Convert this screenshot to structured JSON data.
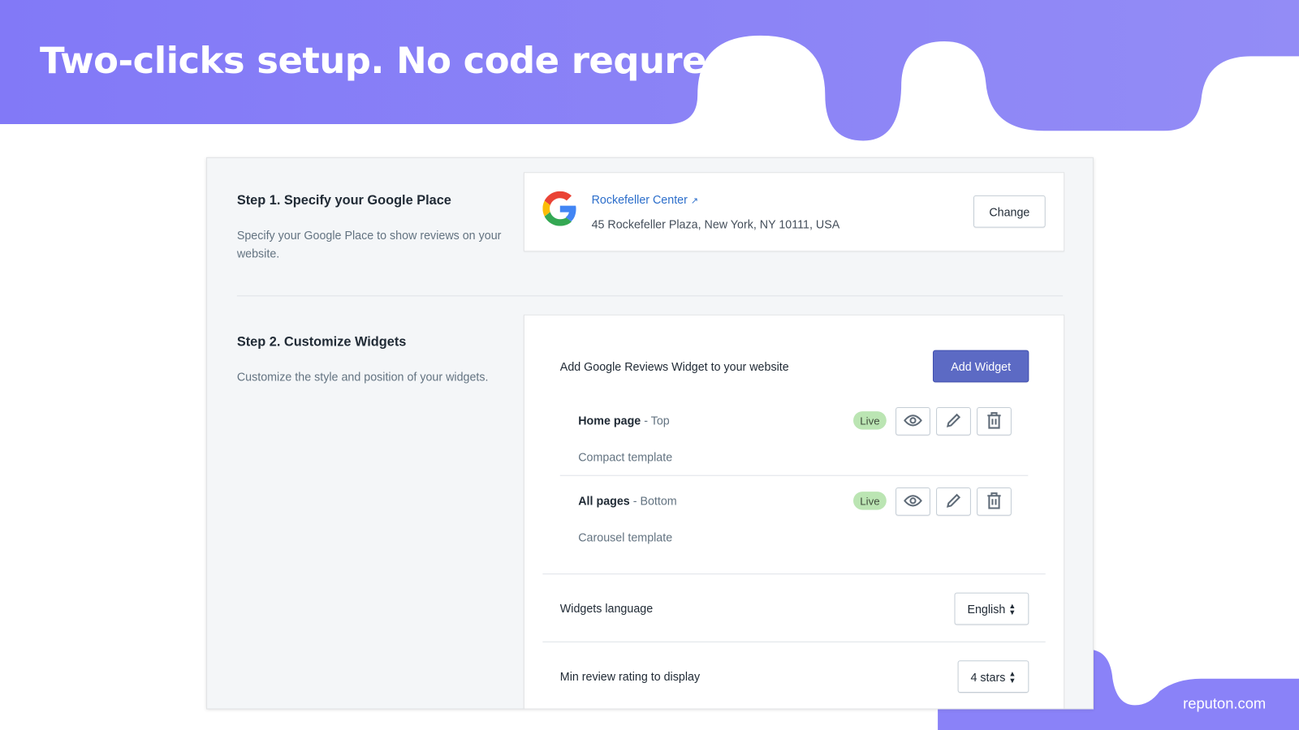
{
  "headline": "Two-clicks setup. No code requred",
  "brand": "reputon.com",
  "colors": {
    "banner": "#8a82f8",
    "accent": "#5c6ac4",
    "live": "#bbe5b3"
  },
  "step1": {
    "title": "Step 1. Specify your Google Place",
    "description": "Specify your Google Place to show reviews on your website.",
    "place_name": "Rockefeller Center",
    "place_address": "45 Rockefeller Plaza, New York, NY 10111, USA",
    "change_label": "Change",
    "logo_icon": "google-logo",
    "link_icon": "external-link-icon"
  },
  "step2": {
    "title": "Step 2. Customize Widgets",
    "description": "Customize the style and position of your widgets.",
    "add_text": "Add Google Reviews Widget to your website",
    "add_button": "Add Widget",
    "widgets": [
      {
        "page": "Home page",
        "position": "- Top",
        "template": "Compact template",
        "status": "Live"
      },
      {
        "page": "All pages",
        "position": "- Bottom",
        "template": "Carousel template",
        "status": "Live"
      }
    ],
    "language_label": "Widgets language",
    "language_value": "English",
    "rating_label": "Min review rating to display",
    "rating_value": "4 stars"
  }
}
